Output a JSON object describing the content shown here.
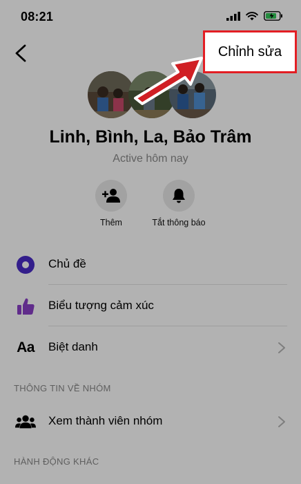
{
  "status_bar": {
    "time": "08:21"
  },
  "nav": {
    "edit_label": "Chỉnh sửa"
  },
  "group": {
    "name": "Linh, Bình, La, Bảo Trâm",
    "active_status": "Active hôm nay"
  },
  "actions": [
    {
      "label": "Thêm",
      "icon": "add-person-icon"
    },
    {
      "label": "Tắt thông báo",
      "icon": "bell-icon"
    }
  ],
  "menu": [
    {
      "label": "Chủ đề",
      "icon": "theme-circle-icon",
      "chevron": false
    },
    {
      "label": "Biểu tượng cảm xúc",
      "icon": "thumbs-up-icon",
      "chevron": false
    },
    {
      "label": "Biệt danh",
      "icon": "aa-text-icon",
      "chevron": true
    }
  ],
  "sections": {
    "group_info": "THÔNG TIN VỀ NHÓM",
    "other_actions": "HÀNH ĐỘNG KHÁC"
  },
  "group_menu": [
    {
      "label": "Xem thành viên nhóm",
      "icon": "people-icon",
      "chevron": true
    }
  ],
  "colors": {
    "highlight_border": "#e31e24",
    "theme_accent": "#4a2bc7",
    "thumb_accent": "#8a3fc7"
  }
}
